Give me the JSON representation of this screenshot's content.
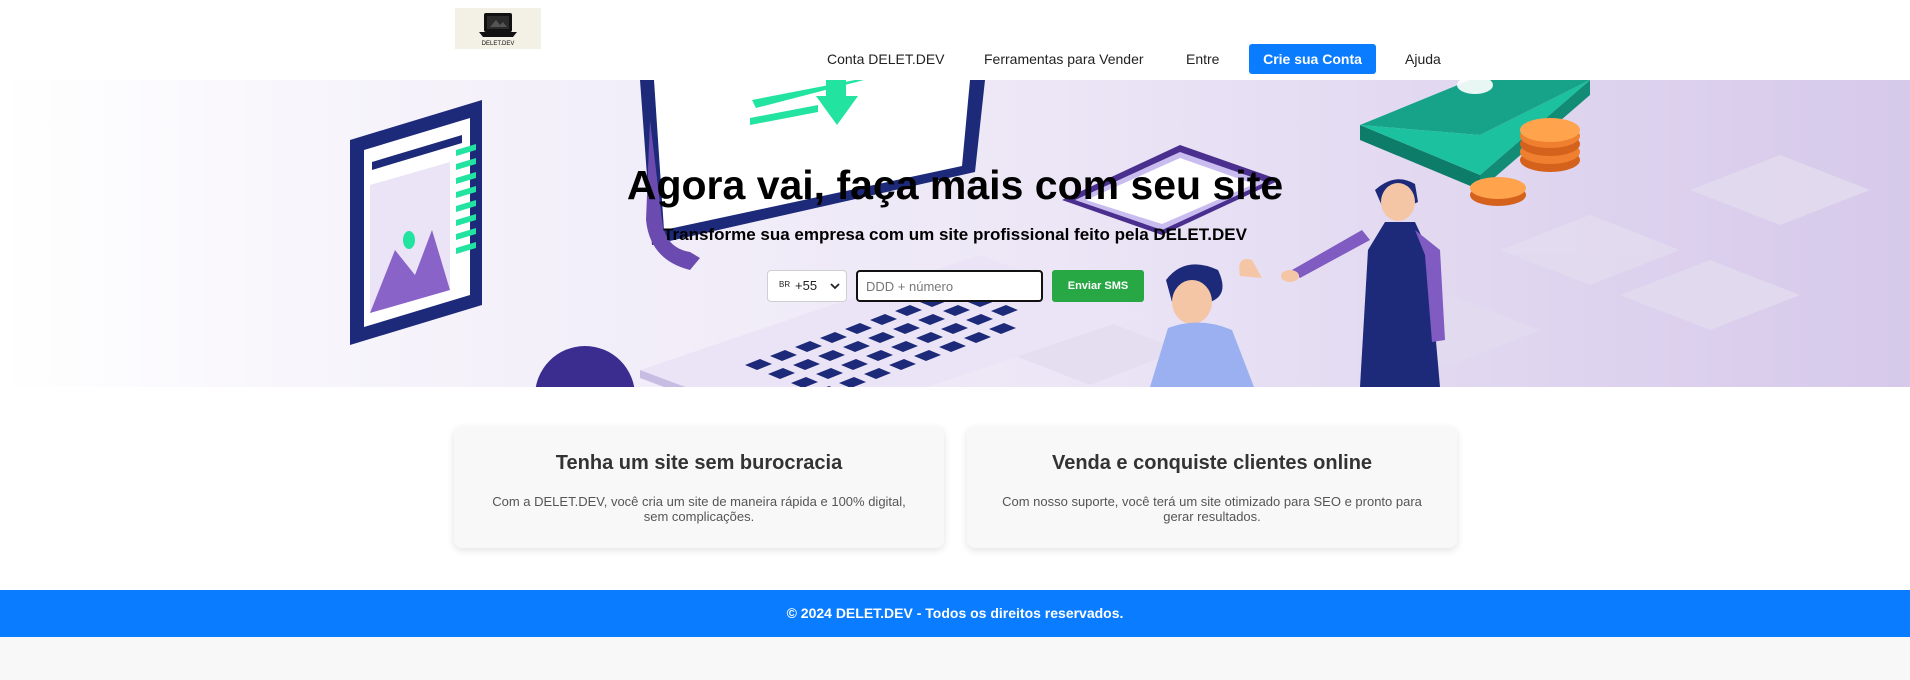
{
  "header": {
    "logo_text": "DELET.DEV",
    "nav": {
      "conta": "Conta DELET.DEV",
      "ferramentas": "Ferramentas para Vender",
      "entre": "Entre",
      "crie_conta": "Crie sua Conta",
      "ajuda": "Ajuda"
    }
  },
  "hero": {
    "title": "Agora vai, faça mais com seu site",
    "subtitle": "Transforme sua empresa com um site profissional feito pela DELET.DEV",
    "form": {
      "country_code": "BR",
      "dial_code": "+55",
      "phone_placeholder": "DDD + número",
      "submit_label": "Enviar SMS"
    }
  },
  "features": [
    {
      "title": "Tenha um site sem burocracia",
      "text": "Com a DELET.DEV, você cria um site de maneira rápida e 100% digital, sem complicações."
    },
    {
      "title": "Venda e conquiste clientes online",
      "text": "Com nosso suporte, você terá um site otimizado para SEO e pronto para gerar resultados."
    }
  ],
  "footer": {
    "copyright": "© 2024 DELET.DEV - Todos os direitos reservados."
  },
  "colors": {
    "primary": "#0a7cff",
    "success": "#28a745",
    "illustration_navy": "#1d2a7a",
    "illustration_green": "#22e3a0",
    "illustration_purple": "#7f5bc2"
  }
}
